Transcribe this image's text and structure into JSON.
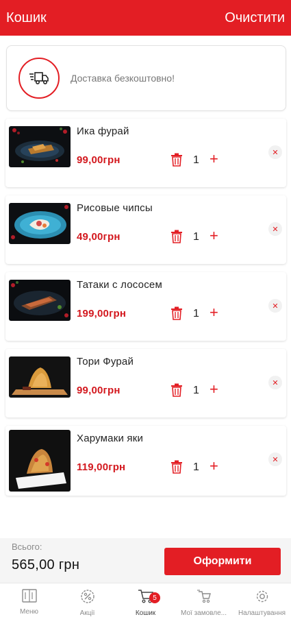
{
  "header": {
    "title": "Кошик",
    "clear_label": "Очистити"
  },
  "delivery": {
    "icon": "delivery-truck-icon",
    "text": "Доставка безкоштовно!"
  },
  "cart": {
    "items": [
      {
        "name": "Ика фурай",
        "price": "99,00грн",
        "qty": "1",
        "image": "dish-photo"
      },
      {
        "name": "Рисовые чипсы",
        "price": "49,00грн",
        "qty": "1",
        "image": "dish-photo"
      },
      {
        "name": "Татаки с лососем",
        "price": "199,00грн",
        "qty": "1",
        "image": "dish-photo"
      },
      {
        "name": "Тори Фурай",
        "price": "99,00грн",
        "qty": "1",
        "image": "dish-photo"
      },
      {
        "name": "Харумаки яки",
        "price": "119,00грн",
        "qty": "1",
        "image": "dish-photo"
      }
    ],
    "plus_symbol": "+",
    "remove_symbol": "✕"
  },
  "total": {
    "label": "Всього:",
    "amount": "565,00 грн",
    "checkout_label": "Оформити"
  },
  "nav": {
    "tabs": [
      {
        "label": "Меню",
        "icon": "menu-book-icon"
      },
      {
        "label": "Акції",
        "icon": "percent-badge-icon"
      },
      {
        "label": "Кошик",
        "icon": "cart-icon",
        "badge": "5"
      },
      {
        "label": "Мої замовле...",
        "icon": "orders-icon"
      },
      {
        "label": "Налаштування",
        "icon": "gear-icon"
      }
    ]
  },
  "colors": {
    "accent": "#e31e24",
    "price": "#d3181e",
    "muted": "#8c8c8c"
  }
}
